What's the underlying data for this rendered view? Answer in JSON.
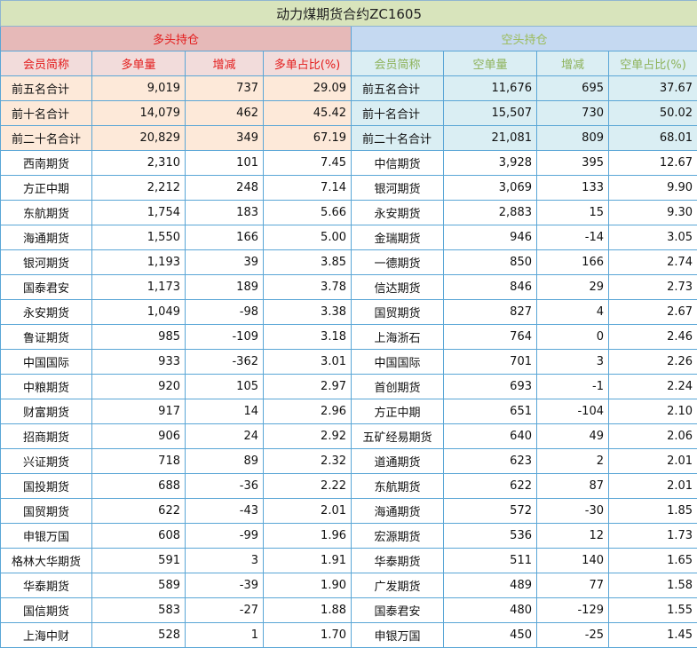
{
  "title": "动力煤期货合约ZC1605",
  "long_group": "多头持仓",
  "short_group": "空头持仓",
  "long_headers": [
    "会员简称",
    "多单量",
    "增减",
    "多单占比(%)"
  ],
  "short_headers": [
    "会员简称",
    "空单量",
    "增减",
    "空单占比(%)"
  ],
  "summary": [
    {
      "long": [
        "前五名合计",
        "9,019",
        "737",
        "29.09"
      ],
      "short": [
        "前五名合计",
        "11,676",
        "695",
        "37.67"
      ]
    },
    {
      "long": [
        "前十名合计",
        "14,079",
        "462",
        "45.42"
      ],
      "short": [
        "前十名合计",
        "15,507",
        "730",
        "50.02"
      ]
    },
    {
      "long": [
        "前二十名合计",
        "20,829",
        "349",
        "67.19"
      ],
      "short": [
        "前二十名合计",
        "21,081",
        "809",
        "68.01"
      ]
    }
  ],
  "rows": [
    {
      "long": [
        "西南期货",
        "2,310",
        "101",
        "7.45"
      ],
      "short": [
        "中信期货",
        "3,928",
        "395",
        "12.67"
      ]
    },
    {
      "long": [
        "方正中期",
        "2,212",
        "248",
        "7.14"
      ],
      "short": [
        "银河期货",
        "3,069",
        "133",
        "9.90"
      ]
    },
    {
      "long": [
        "东航期货",
        "1,754",
        "183",
        "5.66"
      ],
      "short": [
        "永安期货",
        "2,883",
        "15",
        "9.30"
      ]
    },
    {
      "long": [
        "海通期货",
        "1,550",
        "166",
        "5.00"
      ],
      "short": [
        "金瑞期货",
        "946",
        "-14",
        "3.05"
      ]
    },
    {
      "long": [
        "银河期货",
        "1,193",
        "39",
        "3.85"
      ],
      "short": [
        "一德期货",
        "850",
        "166",
        "2.74"
      ]
    },
    {
      "long": [
        "国泰君安",
        "1,173",
        "189",
        "3.78"
      ],
      "short": [
        "信达期货",
        "846",
        "29",
        "2.73"
      ]
    },
    {
      "long": [
        "永安期货",
        "1,049",
        "-98",
        "3.38"
      ],
      "short": [
        "国贸期货",
        "827",
        "4",
        "2.67"
      ]
    },
    {
      "long": [
        "鲁证期货",
        "985",
        "-109",
        "3.18"
      ],
      "short": [
        "上海浙石",
        "764",
        "0",
        "2.46"
      ]
    },
    {
      "long": [
        "中国国际",
        "933",
        "-362",
        "3.01"
      ],
      "short": [
        "中国国际",
        "701",
        "3",
        "2.26"
      ]
    },
    {
      "long": [
        "中粮期货",
        "920",
        "105",
        "2.97"
      ],
      "short": [
        "首创期货",
        "693",
        "-1",
        "2.24"
      ]
    },
    {
      "long": [
        "财富期货",
        "917",
        "14",
        "2.96"
      ],
      "short": [
        "方正中期",
        "651",
        "-104",
        "2.10"
      ]
    },
    {
      "long": [
        "招商期货",
        "906",
        "24",
        "2.92"
      ],
      "short": [
        "五矿经易期货",
        "640",
        "49",
        "2.06"
      ]
    },
    {
      "long": [
        "兴证期货",
        "718",
        "89",
        "2.32"
      ],
      "short": [
        "道通期货",
        "623",
        "2",
        "2.01"
      ]
    },
    {
      "long": [
        "国投期货",
        "688",
        "-36",
        "2.22"
      ],
      "short": [
        "东航期货",
        "622",
        "87",
        "2.01"
      ]
    },
    {
      "long": [
        "国贸期货",
        "622",
        "-43",
        "2.01"
      ],
      "short": [
        "海通期货",
        "572",
        "-30",
        "1.85"
      ]
    },
    {
      "long": [
        "申银万国",
        "608",
        "-99",
        "1.96"
      ],
      "short": [
        "宏源期货",
        "536",
        "12",
        "1.73"
      ]
    },
    {
      "long": [
        "格林大华期货",
        "591",
        "3",
        "1.91"
      ],
      "short": [
        "华泰期货",
        "511",
        "140",
        "1.65"
      ]
    },
    {
      "long": [
        "华泰期货",
        "589",
        "-39",
        "1.90"
      ],
      "short": [
        "广发期货",
        "489",
        "77",
        "1.58"
      ]
    },
    {
      "long": [
        "国信期货",
        "583",
        "-27",
        "1.88"
      ],
      "short": [
        "国泰君安",
        "480",
        "-129",
        "1.55"
      ]
    },
    {
      "long": [
        "上海中财",
        "528",
        "1",
        "1.70"
      ],
      "short": [
        "申银万国",
        "450",
        "-25",
        "1.45"
      ]
    }
  ]
}
